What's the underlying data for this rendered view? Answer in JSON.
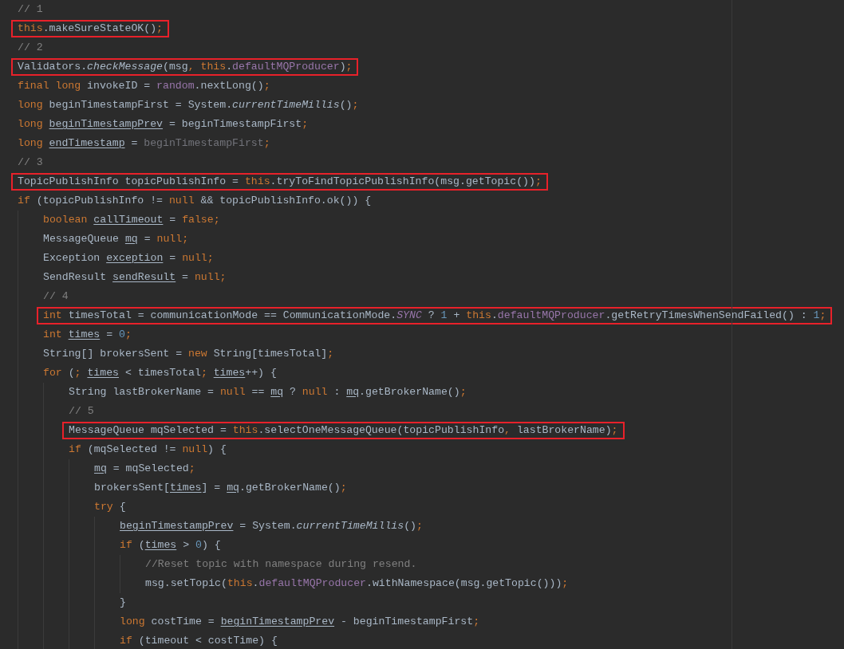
{
  "editor": {
    "lines": [
      {
        "highlighted": false,
        "tokens": [
          {
            "text": "// 1",
            "kind": "comment"
          }
        ]
      },
      {
        "highlighted": true,
        "tokens": [
          {
            "text": "this",
            "kind": "keyword"
          },
          {
            "text": ".makeSureStateOK()",
            "kind": "text"
          },
          {
            "text": ";",
            "kind": "punct"
          }
        ]
      },
      {
        "highlighted": false,
        "tokens": [
          {
            "text": "// 2",
            "kind": "comment"
          }
        ]
      },
      {
        "highlighted": true,
        "tokens": [
          {
            "text": "Validators.",
            "kind": "text"
          },
          {
            "text": "checkMessage",
            "kind": "static-call"
          },
          {
            "text": "(msg",
            "kind": "text"
          },
          {
            "text": ", ",
            "kind": "punct"
          },
          {
            "text": "this",
            "kind": "keyword"
          },
          {
            "text": ".",
            "kind": "text"
          },
          {
            "text": "defaultMQProducer",
            "kind": "field"
          },
          {
            "text": ")",
            "kind": "text"
          },
          {
            "text": ";",
            "kind": "punct"
          }
        ]
      },
      {
        "highlighted": false,
        "tokens": [
          {
            "text": "final long",
            "kind": "keyword"
          },
          {
            "text": " invokeID = ",
            "kind": "text"
          },
          {
            "text": "random",
            "kind": "field"
          },
          {
            "text": ".nextLong()",
            "kind": "text"
          },
          {
            "text": ";",
            "kind": "punct"
          }
        ]
      },
      {
        "highlighted": false,
        "tokens": [
          {
            "text": "long",
            "kind": "keyword"
          },
          {
            "text": " beginTimestampFirst = System.",
            "kind": "text"
          },
          {
            "text": "currentTimeMillis",
            "kind": "static-call"
          },
          {
            "text": "()",
            "kind": "text"
          },
          {
            "text": ";",
            "kind": "punct"
          }
        ]
      },
      {
        "highlighted": false,
        "tokens": [
          {
            "text": "long ",
            "kind": "keyword"
          },
          {
            "text": "beginTimestampPrev",
            "kind": "var"
          },
          {
            "text": " = beginTimestampFirst",
            "kind": "text"
          },
          {
            "text": ";",
            "kind": "punct"
          }
        ]
      },
      {
        "highlighted": false,
        "tokens": [
          {
            "text": "long ",
            "kind": "keyword"
          },
          {
            "text": "endTimestamp",
            "kind": "var"
          },
          {
            "text": " = ",
            "kind": "text"
          },
          {
            "text": "beginTimestampFirst",
            "kind": "unused"
          },
          {
            "text": ";",
            "kind": "punct"
          }
        ]
      },
      {
        "highlighted": false,
        "tokens": [
          {
            "text": "// 3",
            "kind": "comment"
          }
        ]
      },
      {
        "highlighted": true,
        "tokens": [
          {
            "text": "TopicPublishInfo topicPublishInfo = ",
            "kind": "text"
          },
          {
            "text": "this",
            "kind": "keyword"
          },
          {
            "text": ".tryToFindTopicPublishInfo(msg.getTopic())",
            "kind": "text"
          },
          {
            "text": ";",
            "kind": "punct"
          }
        ]
      },
      {
        "highlighted": false,
        "tokens": [
          {
            "text": "if",
            "kind": "keyword"
          },
          {
            "text": " (topicPublishInfo != ",
            "kind": "text"
          },
          {
            "text": "null",
            "kind": "keyword"
          },
          {
            "text": " && topicPublishInfo.ok()) {",
            "kind": "text"
          }
        ]
      },
      {
        "highlighted": false,
        "tokens": [
          {
            "text": "    boolean ",
            "kind": "keyword"
          },
          {
            "text": "callTimeout",
            "kind": "var"
          },
          {
            "text": " = ",
            "kind": "text"
          },
          {
            "text": "false",
            "kind": "keyword"
          },
          {
            "text": ";",
            "kind": "punct"
          }
        ]
      },
      {
        "highlighted": false,
        "tokens": [
          {
            "text": "    MessageQueue ",
            "kind": "text"
          },
          {
            "text": "mq",
            "kind": "var"
          },
          {
            "text": " = ",
            "kind": "text"
          },
          {
            "text": "null",
            "kind": "keyword"
          },
          {
            "text": ";",
            "kind": "punct"
          }
        ]
      },
      {
        "highlighted": false,
        "tokens": [
          {
            "text": "    Exception ",
            "kind": "text"
          },
          {
            "text": "exception",
            "kind": "var"
          },
          {
            "text": " = ",
            "kind": "text"
          },
          {
            "text": "null",
            "kind": "keyword"
          },
          {
            "text": ";",
            "kind": "punct"
          }
        ]
      },
      {
        "highlighted": false,
        "tokens": [
          {
            "text": "    SendResult ",
            "kind": "text"
          },
          {
            "text": "sendResult",
            "kind": "var"
          },
          {
            "text": " = ",
            "kind": "text"
          },
          {
            "text": "null",
            "kind": "keyword"
          },
          {
            "text": ";",
            "kind": "punct"
          }
        ]
      },
      {
        "highlighted": false,
        "tokens": [
          {
            "text": "    // 4",
            "kind": "comment"
          }
        ]
      },
      {
        "highlighted": true,
        "tokens": [
          {
            "text": "    int",
            "kind": "keyword"
          },
          {
            "text": " timesTotal = communicationMode == CommunicationMode.",
            "kind": "text"
          },
          {
            "text": "SYNC",
            "kind": "constant"
          },
          {
            "text": " ? ",
            "kind": "text"
          },
          {
            "text": "1",
            "kind": "number"
          },
          {
            "text": " + ",
            "kind": "text"
          },
          {
            "text": "this",
            "kind": "keyword"
          },
          {
            "text": ".",
            "kind": "text"
          },
          {
            "text": "defaultMQProducer",
            "kind": "field"
          },
          {
            "text": ".getRetryTimesWhenSendFailed() : ",
            "kind": "text"
          },
          {
            "text": "1",
            "kind": "number"
          },
          {
            "text": ";",
            "kind": "punct"
          }
        ]
      },
      {
        "highlighted": false,
        "tokens": [
          {
            "text": "    int ",
            "kind": "keyword"
          },
          {
            "text": "times",
            "kind": "var"
          },
          {
            "text": " = ",
            "kind": "text"
          },
          {
            "text": "0",
            "kind": "number"
          },
          {
            "text": ";",
            "kind": "punct"
          }
        ]
      },
      {
        "highlighted": false,
        "tokens": [
          {
            "text": "    String[] brokersSent = ",
            "kind": "text"
          },
          {
            "text": "new",
            "kind": "keyword"
          },
          {
            "text": " String[timesTotal]",
            "kind": "text"
          },
          {
            "text": ";",
            "kind": "punct"
          }
        ]
      },
      {
        "highlighted": false,
        "tokens": [
          {
            "text": "    for",
            "kind": "keyword"
          },
          {
            "text": " (",
            "kind": "text"
          },
          {
            "text": "; ",
            "kind": "punct"
          },
          {
            "text": "times",
            "kind": "var"
          },
          {
            "text": " < timesTotal",
            "kind": "text"
          },
          {
            "text": "; ",
            "kind": "punct"
          },
          {
            "text": "times",
            "kind": "var"
          },
          {
            "text": "++) {",
            "kind": "text"
          }
        ]
      },
      {
        "highlighted": false,
        "tokens": [
          {
            "text": "        String lastBrokerName = ",
            "kind": "text"
          },
          {
            "text": "null",
            "kind": "keyword"
          },
          {
            "text": " == ",
            "kind": "text"
          },
          {
            "text": "mq",
            "kind": "var"
          },
          {
            "text": " ? ",
            "kind": "text"
          },
          {
            "text": "null",
            "kind": "keyword"
          },
          {
            "text": " : ",
            "kind": "text"
          },
          {
            "text": "mq",
            "kind": "var"
          },
          {
            "text": ".getBrokerName()",
            "kind": "text"
          },
          {
            "text": ";",
            "kind": "punct"
          }
        ]
      },
      {
        "highlighted": false,
        "tokens": [
          {
            "text": "        // 5",
            "kind": "comment"
          }
        ]
      },
      {
        "highlighted": true,
        "tokens": [
          {
            "text": "        MessageQueue mqSelected = ",
            "kind": "text"
          },
          {
            "text": "this",
            "kind": "keyword"
          },
          {
            "text": ".selectOneMessageQueue(topicPublishInfo",
            "kind": "text"
          },
          {
            "text": ", ",
            "kind": "punct"
          },
          {
            "text": "lastBrokerName)",
            "kind": "text"
          },
          {
            "text": ";",
            "kind": "punct"
          }
        ]
      },
      {
        "highlighted": false,
        "tokens": [
          {
            "text": "        if",
            "kind": "keyword"
          },
          {
            "text": " (mqSelected != ",
            "kind": "text"
          },
          {
            "text": "null",
            "kind": "keyword"
          },
          {
            "text": ") {",
            "kind": "text"
          }
        ]
      },
      {
        "highlighted": false,
        "tokens": [
          {
            "text": "            mq",
            "kind": "var"
          },
          {
            "text": " = mqSelected",
            "kind": "text"
          },
          {
            "text": ";",
            "kind": "punct"
          }
        ]
      },
      {
        "highlighted": false,
        "tokens": [
          {
            "text": "            brokersSent[",
            "kind": "text"
          },
          {
            "text": "times",
            "kind": "var"
          },
          {
            "text": "] = ",
            "kind": "text"
          },
          {
            "text": "mq",
            "kind": "var"
          },
          {
            "text": ".getBrokerName()",
            "kind": "text"
          },
          {
            "text": ";",
            "kind": "punct"
          }
        ]
      },
      {
        "highlighted": false,
        "tokens": [
          {
            "text": "            try",
            "kind": "keyword"
          },
          {
            "text": " {",
            "kind": "text"
          }
        ]
      },
      {
        "highlighted": false,
        "tokens": [
          {
            "text": "                beginTimestampPrev",
            "kind": "var"
          },
          {
            "text": " = System.",
            "kind": "text"
          },
          {
            "text": "currentTimeMillis",
            "kind": "static-call"
          },
          {
            "text": "()",
            "kind": "text"
          },
          {
            "text": ";",
            "kind": "punct"
          }
        ]
      },
      {
        "highlighted": false,
        "tokens": [
          {
            "text": "                if",
            "kind": "keyword"
          },
          {
            "text": " (",
            "kind": "text"
          },
          {
            "text": "times",
            "kind": "var"
          },
          {
            "text": " > ",
            "kind": "text"
          },
          {
            "text": "0",
            "kind": "number"
          },
          {
            "text": ") {",
            "kind": "text"
          }
        ]
      },
      {
        "highlighted": false,
        "tokens": [
          {
            "text": "                    //Reset topic with namespace during resend.",
            "kind": "comment"
          }
        ]
      },
      {
        "highlighted": false,
        "tokens": [
          {
            "text": "                    msg.setTopic(",
            "kind": "text"
          },
          {
            "text": "this",
            "kind": "keyword"
          },
          {
            "text": ".",
            "kind": "text"
          },
          {
            "text": "defaultMQProducer",
            "kind": "field"
          },
          {
            "text": ".withNamespace(msg.getTopic()))",
            "kind": "text"
          },
          {
            "text": ";",
            "kind": "punct"
          }
        ]
      },
      {
        "highlighted": false,
        "tokens": [
          {
            "text": "                }",
            "kind": "text"
          }
        ]
      },
      {
        "highlighted": false,
        "tokens": [
          {
            "text": "                long",
            "kind": "keyword"
          },
          {
            "text": " costTime = ",
            "kind": "text"
          },
          {
            "text": "beginTimestampPrev",
            "kind": "var"
          },
          {
            "text": " - beginTimestampFirst",
            "kind": "text"
          },
          {
            "text": ";",
            "kind": "punct"
          }
        ]
      },
      {
        "highlighted": false,
        "tokens": [
          {
            "text": "                if",
            "kind": "keyword"
          },
          {
            "text": " (timeout < costTime) {",
            "kind": "text"
          }
        ]
      }
    ]
  }
}
